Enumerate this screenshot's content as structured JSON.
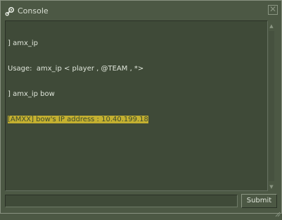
{
  "window": {
    "title": "Console",
    "title_icon": "steam-logo-icon",
    "close_glyph": "✕"
  },
  "console": {
    "lines": [
      "] amx_ip",
      "Usage:  amx_ip < player , @TEAM , *>",
      "] amx_ip bow",
      "[AMXX] bow's IP address : 10.40.199.18"
    ],
    "highlighted_line": 3
  },
  "input": {
    "value": "",
    "placeholder": ""
  },
  "buttons": {
    "submit_label": "Submit"
  },
  "colors": {
    "window_bg": "#4c5844",
    "panel_bg": "#3f4a38",
    "text": "#dfe5da",
    "highlight_bg": "#c4b030",
    "highlight_text": "#3d4a2f"
  }
}
